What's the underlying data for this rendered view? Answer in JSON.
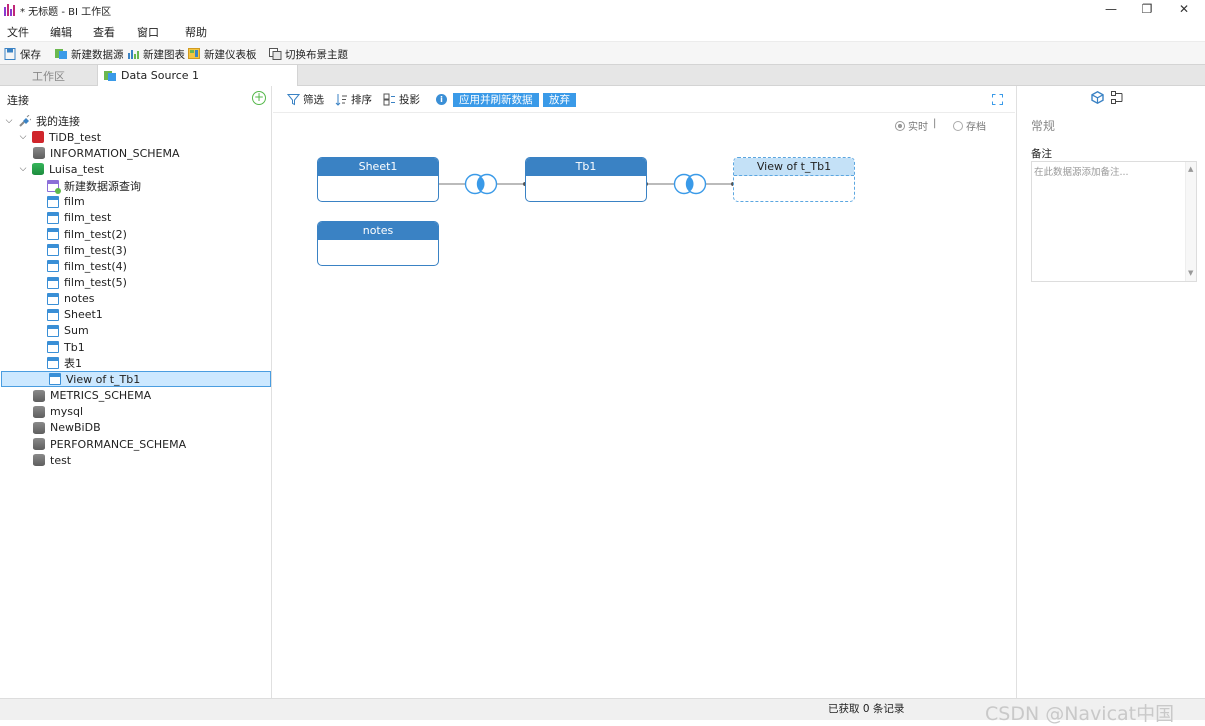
{
  "window": {
    "title": "* 无标题 - BI 工作区",
    "minimize_glyph": "—",
    "maximize_glyph": "❐",
    "close_glyph": "✕",
    "logo_icon": "bi-logo-icon"
  },
  "menu": [
    "文件",
    "编辑",
    "查看",
    "窗口",
    "帮助"
  ],
  "toolbar": {
    "save": "保存",
    "new_datasource": "新建数据源",
    "new_chart": "新建图表",
    "new_dashboard": "新建仪表板",
    "switch_theme": "切换布景主题"
  },
  "tabs": {
    "workspace": "工作区",
    "datasource": "Data Source 1"
  },
  "left_panel": {
    "header": "连接",
    "add_glyph": "+",
    "tree": [
      {
        "label": "我的连接",
        "icon": "connection-icon",
        "chevron": "expanded",
        "level": 0
      },
      {
        "label": "TiDB_test",
        "icon": "tidb-icon",
        "chevron": "expanded",
        "level": 1
      },
      {
        "label": "INFORMATION_SCHEMA",
        "icon": "database-icon",
        "chevron": "none",
        "level": 2
      },
      {
        "label": "Luisa_test",
        "icon": "database-active-icon",
        "chevron": "expanded",
        "level": 1
      },
      {
        "label": "新建数据源查询",
        "icon": "query-icon",
        "chevron": "none",
        "level": 3
      },
      {
        "label": "film",
        "icon": "table-icon",
        "chevron": "none",
        "level": 3
      },
      {
        "label": "film_test",
        "icon": "table-icon",
        "chevron": "none",
        "level": 3
      },
      {
        "label": "film_test(2)",
        "icon": "table-icon",
        "chevron": "none",
        "level": 3
      },
      {
        "label": "film_test(3)",
        "icon": "table-icon",
        "chevron": "none",
        "level": 3
      },
      {
        "label": "film_test(4)",
        "icon": "table-icon",
        "chevron": "none",
        "level": 3
      },
      {
        "label": "film_test(5)",
        "icon": "table-icon",
        "chevron": "none",
        "level": 3
      },
      {
        "label": "notes",
        "icon": "table-icon",
        "chevron": "none",
        "level": 3
      },
      {
        "label": "Sheet1",
        "icon": "table-icon",
        "chevron": "none",
        "level": 3
      },
      {
        "label": "Sum",
        "icon": "table-icon",
        "chevron": "none",
        "level": 3
      },
      {
        "label": "Tb1",
        "icon": "table-icon",
        "chevron": "none",
        "level": 3
      },
      {
        "label": "表1",
        "icon": "table-icon",
        "chevron": "none",
        "level": 3
      },
      {
        "label": "View of t_Tb1",
        "icon": "view-icon",
        "chevron": "none",
        "level": 3,
        "selected": true
      },
      {
        "label": "METRICS_SCHEMA",
        "icon": "database-icon",
        "chevron": "none",
        "level": 2
      },
      {
        "label": "mysql",
        "icon": "database-icon",
        "chevron": "none",
        "level": 2
      },
      {
        "label": "NewBiDB",
        "icon": "database-icon",
        "chevron": "none",
        "level": 2
      },
      {
        "label": "PERFORMANCE_SCHEMA",
        "icon": "database-icon",
        "chevron": "none",
        "level": 2
      },
      {
        "label": "test",
        "icon": "database-icon",
        "chevron": "none",
        "level": 2
      }
    ]
  },
  "center_toolbar": {
    "filter": "筛选",
    "sort": "排序",
    "projection": "投影",
    "info_glyph": "i",
    "apply_refresh": "应用并刷新数据",
    "discard": "放弃",
    "mode_live": "实时",
    "mode_separator": "|",
    "mode_archive": "存档",
    "selected_mode": "live"
  },
  "canvas": {
    "nodes": {
      "sheet1": "Sheet1",
      "tb1": "Tb1",
      "view": "View of t_Tb1",
      "notes": "notes"
    }
  },
  "right_panel": {
    "section_title": "常规",
    "note_label": "备注",
    "note_placeholder": "在此数据源添加备注...",
    "scroll_up_glyph": "▲",
    "scroll_down_glyph": "▼"
  },
  "status": {
    "records": "已获取 0 条记录",
    "watermark": "CSDN @Navicat中国"
  },
  "colors": {
    "accent": "#3a82c4",
    "button_blue": "#3a9ae8",
    "selection": "#cce8ff",
    "view_node": "#c4e1f7"
  }
}
